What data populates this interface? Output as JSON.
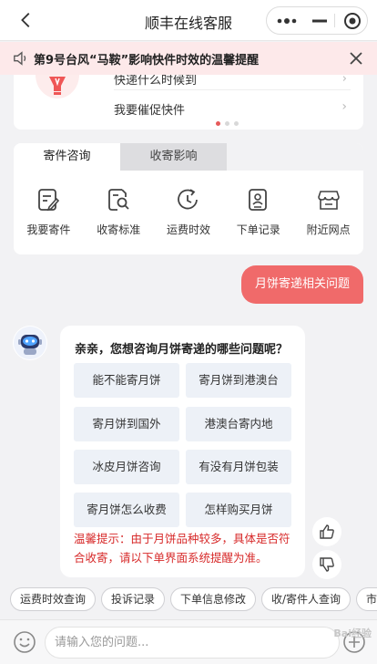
{
  "header": {
    "title": "顺丰在线客服"
  },
  "notice": {
    "text": "第9号台风“马鞍”影响快件时效的温馨提醒"
  },
  "banner": {
    "row1": "快递什么时候到",
    "row2": "我要催促快件",
    "active_dot": 0,
    "dot_count": 3
  },
  "consult": {
    "tabs": [
      {
        "label": "寄件咨询",
        "active": true
      },
      {
        "label": "收寄影响",
        "active": false
      }
    ],
    "tools": [
      {
        "label": "我要寄件",
        "icon": "edit-doc-icon"
      },
      {
        "label": "收寄标准",
        "icon": "doc-search-icon"
      },
      {
        "label": "运费时效",
        "icon": "clock-refresh-icon"
      },
      {
        "label": "下单记录",
        "icon": "profile-card-icon"
      },
      {
        "label": "附近网点",
        "icon": "store-icon"
      }
    ]
  },
  "chat": {
    "user_message": "月饼寄递相关问题",
    "bot_question": "亲亲，您想咨询月饼寄递的哪些问题呢？",
    "options": [
      "能不能寄月饼",
      "寄月饼到港澳台",
      "寄月饼到国外",
      "港澳台寄内地",
      "冰皮月饼咨询",
      "有没有月饼包装",
      "寄月饼怎么收费",
      "怎样购买月饼"
    ],
    "tip": "温馨提示：由于月饼品种较多，具体是否符合收寄，请以下单界面系统提醒为准。"
  },
  "quick_chips": [
    "运费时效查询",
    "投诉记录",
    "下单信息修改",
    "收/寄件人查询",
    "市"
  ],
  "input": {
    "placeholder": "请输入您的问题..."
  },
  "watermark": "Bai经验",
  "colors": {
    "accent": "#f06a6a",
    "notice_bg": "#fde9ea",
    "tip": "#d72a2a"
  }
}
